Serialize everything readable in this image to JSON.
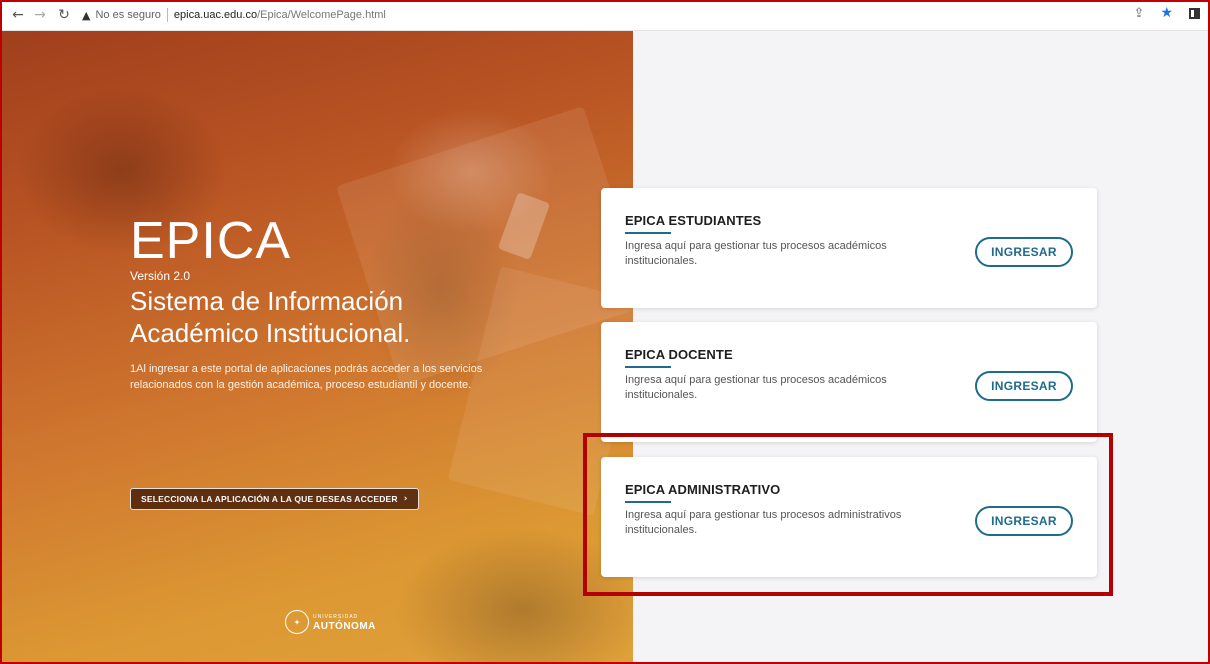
{
  "browser": {
    "security_label": "No es seguro",
    "url_host": "epica.uac.edu.co",
    "url_path": "/Epica/WelcomePage.html"
  },
  "hero": {
    "title": "EPICA",
    "version": "Versión 2.0",
    "system_name_line1": "Sistema de Información",
    "system_name_line2": "Académico Institucional.",
    "description": "1Al ingresar a este portal de aplicaciones podrás acceder a los servicios relacionados con la gestión académica, proceso estudiantil y docente.",
    "select_button": "SELECCIONA LA APLICACIÓN A LA QUE DESEAS ACCEDER",
    "logo_small": "UNIVERSIDAD",
    "logo_big": "AUTÓNOMA"
  },
  "cards": [
    {
      "title": "EPICA ESTUDIANTES",
      "description": "Ingresa aquí para gestionar tus procesos académicos institucionales.",
      "button": "INGRESAR"
    },
    {
      "title": "EPICA DOCENTE",
      "description": "Ingresa aquí para gestionar tus procesos académicos institucionales.",
      "button": "INGRESAR"
    },
    {
      "title": "EPICA ADMINISTRATIVO",
      "description": "Ingresa aquí para gestionar tus procesos administrativos institucionales.",
      "button": "INGRESAR"
    }
  ],
  "colors": {
    "accent": "#1f6b8c",
    "highlight": "#b30000",
    "star": "#1a73e8"
  }
}
